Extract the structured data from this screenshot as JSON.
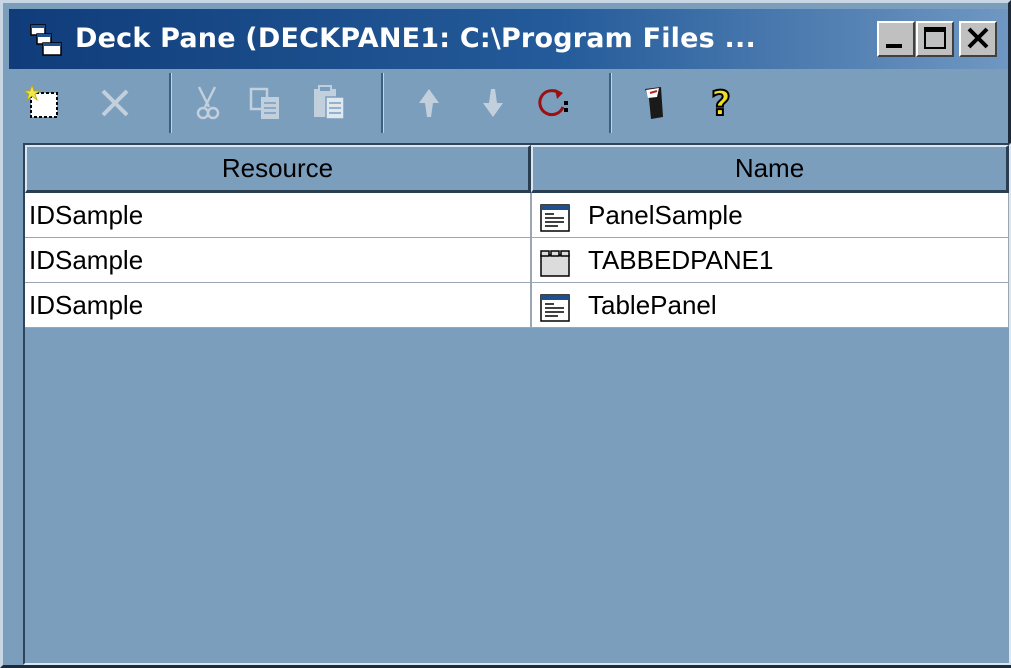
{
  "window": {
    "title": "Deck Pane (DECKPANE1: C:\\Program Files ...",
    "caption_buttons": [
      {
        "name": "minimize",
        "icon": "minimize-icon"
      },
      {
        "name": "maximize",
        "icon": "maximize-icon"
      },
      {
        "name": "close",
        "icon": "close-icon"
      }
    ]
  },
  "toolbar": {
    "buttons": [
      {
        "name": "new",
        "icon": "new-item-icon",
        "enabled": true
      },
      {
        "name": "delete",
        "icon": "delete-x-icon",
        "enabled": false
      },
      {
        "name": "cut",
        "icon": "scissors-icon",
        "enabled": false
      },
      {
        "name": "copy",
        "icon": "copy-icon",
        "enabled": false
      },
      {
        "name": "paste",
        "icon": "paste-icon",
        "enabled": false
      },
      {
        "name": "move-up",
        "icon": "arrow-up-icon",
        "enabled": false
      },
      {
        "name": "move-down",
        "icon": "arrow-down-icon",
        "enabled": false
      },
      {
        "name": "refresh",
        "icon": "refresh-icon",
        "enabled": true
      },
      {
        "name": "tools",
        "icon": "tool-icon",
        "enabled": true
      },
      {
        "name": "help",
        "icon": "help-question-icon",
        "enabled": true
      }
    ]
  },
  "table": {
    "columns": [
      "Resource",
      "Name"
    ],
    "rows": [
      {
        "resource": "IDSample",
        "name": "PanelSample",
        "icon": "panel-icon"
      },
      {
        "resource": "IDSample",
        "name": "TABBEDPANE1",
        "icon": "tabbed-pane-icon"
      },
      {
        "resource": "IDSample",
        "name": "TablePanel",
        "icon": "panel-icon"
      }
    ]
  },
  "colors": {
    "titlebar_start": "#103c7a",
    "titlebar_end": "#6f97c2",
    "background": "#7b9ebd"
  }
}
